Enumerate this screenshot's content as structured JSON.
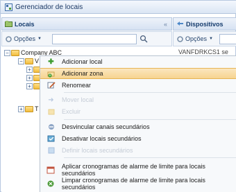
{
  "window": {
    "title": "Gerenciador de locais"
  },
  "left_panel": {
    "title": "Locais",
    "options_label": "Opções",
    "search_value": "",
    "collapse_glyph": "«"
  },
  "right_panel": {
    "title": "Dispositivos",
    "options_label": "Opções",
    "search_value": "",
    "tree_item": "VANFDRKCS1 se"
  },
  "tree": {
    "root": "Company ABC",
    "child1": "V",
    "child_last": "T"
  },
  "context_menu": {
    "items": [
      {
        "label": "Adicionar local",
        "icon": "add-location-icon",
        "enabled": true
      },
      {
        "label": "Adicionar zona",
        "icon": "add-zone-icon",
        "enabled": true,
        "highlighted": true
      },
      {
        "label": "Renomear",
        "icon": "rename-icon",
        "enabled": true
      },
      {
        "label": "Mover local",
        "icon": "move-icon",
        "enabled": false
      },
      {
        "label": "Excluir",
        "icon": "delete-icon",
        "enabled": false
      },
      {
        "label": "Desvincular canais secundários",
        "icon": "unlink-icon",
        "enabled": true
      },
      {
        "label": "Desativar locais secundários",
        "icon": "deactivate-icon",
        "enabled": true
      },
      {
        "label": "Definir locais secundários",
        "icon": "define-icon",
        "enabled": false
      },
      {
        "label": "Aplicar cronogramas de alarme de limite para locais secundários",
        "icon": "schedule-icon",
        "enabled": true
      },
      {
        "label": "Limpar cronogramas de alarme de limite para locais secundários",
        "icon": "clear-schedule-icon",
        "enabled": true
      }
    ]
  },
  "colors": {
    "highlight": "#f6d490",
    "header": "#d6e2f2",
    "accent": "#143b6d"
  }
}
